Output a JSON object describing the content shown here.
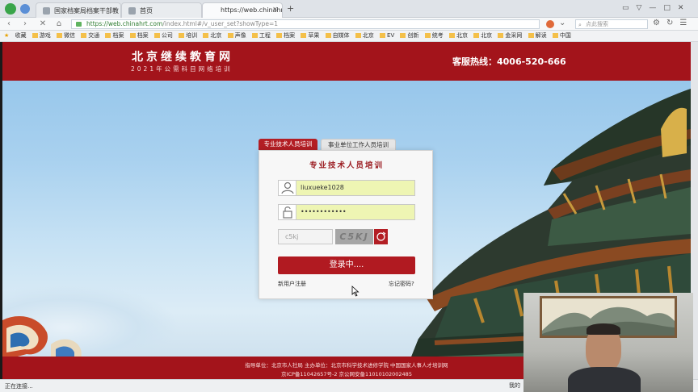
{
  "browser": {
    "tabs": [
      {
        "label": "国家档案局档案干部教"
      },
      {
        "label": "首页"
      },
      {
        "label": "https://web.chinahrt.c"
      }
    ],
    "new_tab_label": "+",
    "url_scheme": "https://",
    "url_host": "web.chinahrt.com",
    "url_path": "/index.html#/v_user_set?showType=1",
    "search_placeholder": "点此搜索",
    "bookmarks": [
      "收藏",
      "游戏",
      "微信",
      "交通",
      "档案",
      "档案",
      "公司",
      "培训",
      "北京",
      "声像",
      "工程",
      "档案",
      "草果",
      "自媒体",
      "北京",
      "EV",
      "创新",
      "统考",
      "北京",
      "北京",
      "金采网",
      "解读",
      "中国"
    ],
    "status_text": "正在连接...",
    "status_right": "我的"
  },
  "header": {
    "title": "北京继续教育网",
    "subtitle": "2021年公需科目网络培训",
    "hotline": "客服热线：4006-520-666"
  },
  "login": {
    "tab_active": "专业技术人员培训",
    "tab_inactive": "事业单位工作人员培训",
    "box_title": "专业技术人员培训",
    "username_value": "liuxueke1028",
    "password_value": "••••••••••••",
    "captcha_placeholder": "c5kj",
    "captcha_image_text": "C5KJ",
    "login_button": "登录中....",
    "register_link": "新用户注册",
    "forgot_link": "忘记密码?"
  },
  "footer": {
    "line1": "指导单位：北京市人社局    主办单位：北京市科学技术进修学院    中国国家人事人才培训网",
    "line2": "京ICP备11042657号-2    京公网安备11010102002485"
  },
  "colors": {
    "brand_red": "#a3141b",
    "input_highlight": "#eef5b3"
  }
}
